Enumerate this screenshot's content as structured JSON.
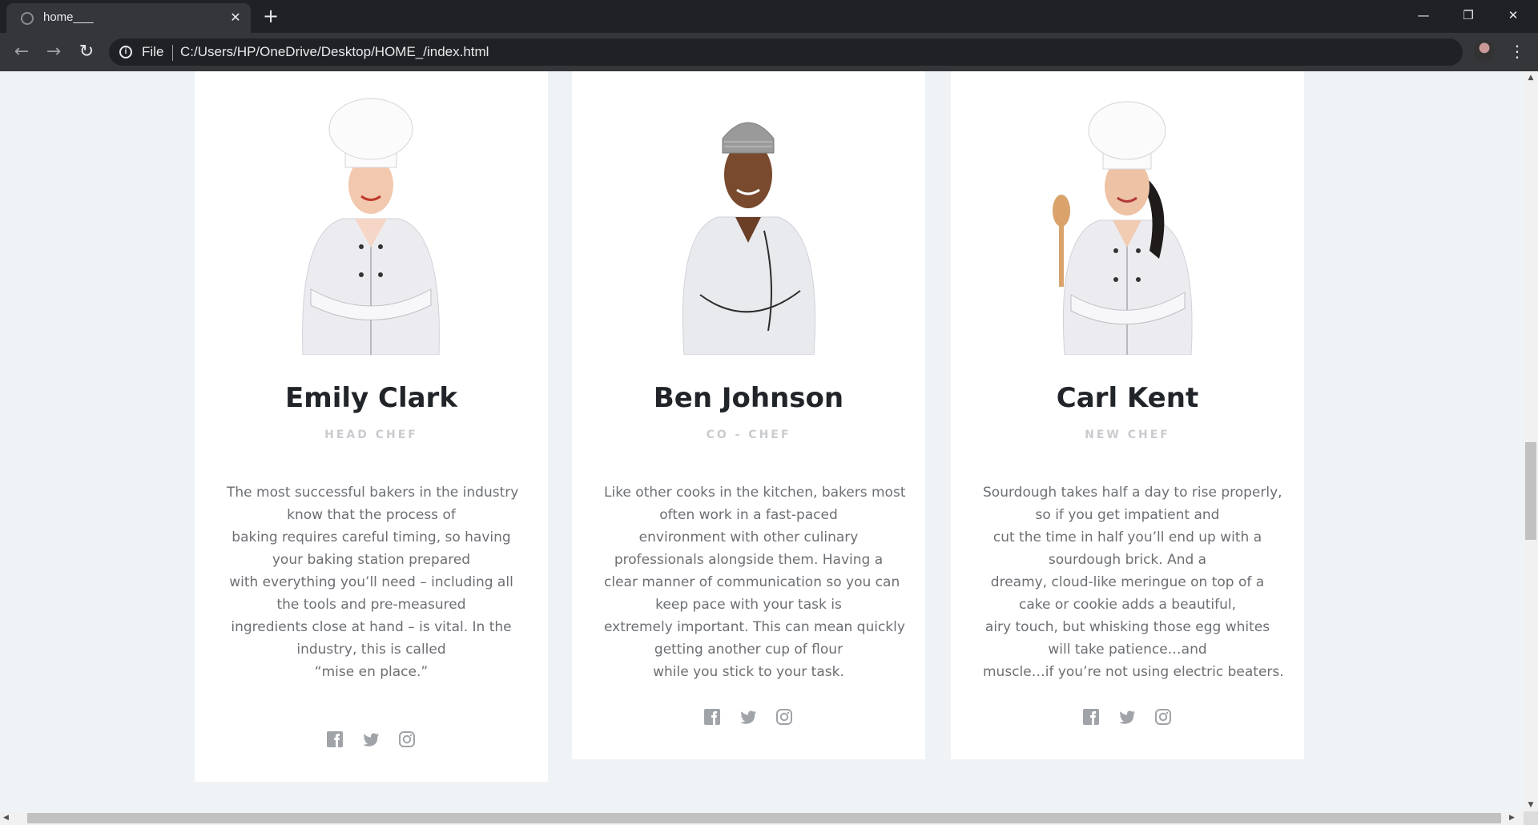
{
  "browser": {
    "tab_title": "home___",
    "tab_close": "✕",
    "new_tab": "+",
    "scheme_label": "File",
    "url": "C:/Users/HP/OneDrive/Desktop/HOME_/index.html",
    "win_minimize": "—",
    "win_restore": "❐",
    "win_close": "✕",
    "back": "←",
    "forward": "→",
    "reload": "↻",
    "info": "i",
    "star": "☆",
    "menu": "⋮"
  },
  "chefs": [
    {
      "name": "Emily Clark",
      "role": "HEAD CHEF",
      "bio_lines": [
        "The most successful bakers in the industry",
        "know that the process of",
        "baking requires careful timing, so having",
        "your baking station prepared",
        "with everything you’ll need – including all",
        "the tools and pre-measured",
        "ingredients close at hand – is vital. In the",
        "industry, this is called",
        "“mise en place.”"
      ],
      "socials": [
        "facebook-icon",
        "twitter-icon",
        "instagram-icon"
      ]
    },
    {
      "name": "Ben Johnson",
      "role": "CO - CHEF",
      "bio_lines": [
        "Like other cooks in the kitchen, bakers most",
        "often work in a fast-paced",
        "environment with other culinary",
        "professionals alongside them. Having a",
        "clear manner of communication so you can",
        "keep pace with your task is",
        "extremely important. This can mean quickly",
        "getting another cup of flour",
        "while you stick to your task."
      ],
      "socials": [
        "facebook-icon",
        "twitter-icon",
        "instagram-icon"
      ]
    },
    {
      "name": "Carl Kent",
      "role": "NEW CHEF",
      "bio_lines": [
        "Sourdough takes half a day to rise properly,",
        "so if you get impatient and",
        "cut the time in half you’ll end up with a",
        "sourdough brick. And a",
        "dreamy, cloud-like meringue on top of a",
        "cake or cookie adds a beautiful,",
        "airy touch, but whisking those egg whites",
        "will take patience…and",
        "muscle…if you’re not using electric beaters."
      ],
      "socials": [
        "facebook-icon",
        "twitter-icon",
        "instagram-icon"
      ]
    }
  ],
  "colors": {
    "page_bg": "#f0f3f6",
    "card_bg": "#ffffff",
    "name": "#212529",
    "role": "#c9cbcf",
    "bio": "#6c6f73",
    "social_icon": "#a0a3a7"
  },
  "scroll": {
    "up": "▲",
    "down": "▼",
    "left": "◀",
    "right": "▶"
  }
}
